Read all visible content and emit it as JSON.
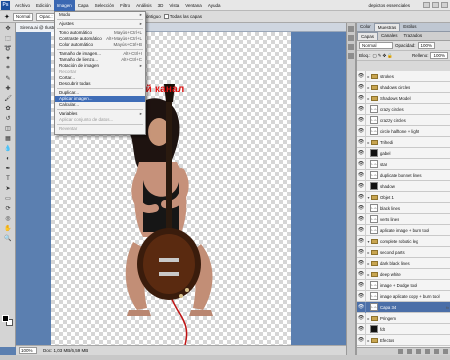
{
  "app": {
    "logo": "Ps",
    "doc_title_right": "depictos essenciales"
  },
  "menubar": [
    "Archivo",
    "Edición",
    "Imagen",
    "Capa",
    "Selección",
    "Filtro",
    "Análisis",
    "3D",
    "Vista",
    "Ventana",
    "Ayuda"
  ],
  "menubar_active_index": 2,
  "options": {
    "mode_label": "Normal",
    "opacity_label": "Opac.: 100%",
    "tolerance_label": "Tolerancia:",
    "tolerance_value": "32",
    "suavizar": "Suavizar",
    "contiguo": "Contiguo",
    "todas_capas": "Todas las capas"
  },
  "doc_tab": "Sirena.ai @ Ilustrador final.ai @ 100% (Capa 34, RGB/8) *",
  "status": {
    "zoom": "100%",
    "doc_info": "Doc: 1,03 MB/6,59 MB"
  },
  "annotation": "Внешний канал",
  "image_menu": {
    "rows": [
      {
        "label": "Modo",
        "shortcut": "▸",
        "disabled": false
      },
      {
        "sep": true
      },
      {
        "label": "Ajustes",
        "shortcut": "▸",
        "disabled": false
      },
      {
        "sep": true
      },
      {
        "label": "Tono automático",
        "shortcut": "Mayús+Ctrl+L",
        "disabled": false
      },
      {
        "label": "Contraste automático",
        "shortcut": "Alt+Mayús+Ctrl+L",
        "disabled": false
      },
      {
        "label": "Color automático",
        "shortcut": "Mayús+Ctrl+B",
        "disabled": false
      },
      {
        "sep": true
      },
      {
        "label": "Tamaño de imagen...",
        "shortcut": "Alt+Ctrl+I",
        "disabled": false
      },
      {
        "label": "Tamaño de lienzo...",
        "shortcut": "Alt+Ctrl+C",
        "disabled": false
      },
      {
        "label": "Rotación de imagen",
        "shortcut": "▸",
        "disabled": false
      },
      {
        "label": "Recortar",
        "shortcut": "",
        "disabled": true
      },
      {
        "label": "Cortar...",
        "shortcut": "",
        "disabled": false
      },
      {
        "label": "Descubrir todas",
        "shortcut": "",
        "disabled": false
      },
      {
        "sep": true
      },
      {
        "label": "Duplicar...",
        "shortcut": "",
        "disabled": false
      },
      {
        "label": "Aplicar imagen...",
        "shortcut": "",
        "disabled": false,
        "highlighted": true
      },
      {
        "label": "Calcular...",
        "shortcut": "",
        "disabled": false
      },
      {
        "sep": true
      },
      {
        "label": "Variables",
        "shortcut": "▸",
        "disabled": false
      },
      {
        "label": "Aplicar conjunto de datos...",
        "shortcut": "",
        "disabled": true
      },
      {
        "sep": true
      },
      {
        "label": "Reventar",
        "shortcut": "",
        "disabled": true
      }
    ]
  },
  "panel": {
    "top_tabs": [
      "Color",
      "Muestras",
      "Estilos"
    ],
    "tabs": [
      "Capas",
      "Canales",
      "Trazados"
    ],
    "blend_mode": "Normal",
    "opacity_label": "Opacidad:",
    "opacity_value": "100%",
    "lock_label": "Bloq.:",
    "fill_label": "Relleno:",
    "fill_value": "100%",
    "layers": [
      {
        "name": "strokes",
        "type": "folder",
        "eye": true,
        "arrow": "▸"
      },
      {
        "name": "shadows circles",
        "type": "folder",
        "eye": true,
        "arrow": "▸"
      },
      {
        "name": "Shadows Model",
        "type": "folder",
        "eye": true,
        "arrow": "▸"
      },
      {
        "name": "crazy circles",
        "type": "layer",
        "thumb": "check",
        "eye": true
      },
      {
        "name": "crazzy circles",
        "type": "layer",
        "thumb": "check",
        "eye": true
      },
      {
        "name": "circle halftone + light",
        "type": "layer",
        "thumb": "check",
        "eye": true
      },
      {
        "name": "Trihedi",
        "type": "folder",
        "eye": true,
        "arrow": "▸"
      },
      {
        "name": "gabel",
        "type": "layer",
        "thumb": "dark",
        "eye": true
      },
      {
        "name": "star",
        "type": "layer",
        "thumb": "check",
        "eye": true
      },
      {
        "name": "duplicate bonnet lines",
        "type": "layer",
        "thumb": "check",
        "eye": true
      },
      {
        "name": "shadow",
        "type": "layer",
        "thumb": "dark",
        "eye": true
      },
      {
        "name": "Objet 1",
        "type": "folder",
        "eye": true,
        "arrow": "▾"
      },
      {
        "name": "black lines",
        "type": "layer",
        "thumb": "check",
        "eye": true
      },
      {
        "name": "verts lines",
        "type": "layer",
        "thumb": "check",
        "eye": true
      },
      {
        "name": "aplicate image + burn tool",
        "type": "layer",
        "thumb": "check",
        "eye": true
      },
      {
        "name": "complete robotic leg",
        "type": "folder",
        "eye": true,
        "arrow": "▾"
      },
      {
        "name": "second parts",
        "type": "folder",
        "eye": true,
        "arrow": "▸"
      },
      {
        "name": "dark black lines",
        "type": "folder",
        "eye": true,
        "arrow": "▸"
      },
      {
        "name": "deep white",
        "type": "folder",
        "eye": true,
        "arrow": "▸"
      },
      {
        "name": "image + Dodge tool",
        "type": "layer",
        "thumb": "check",
        "eye": true
      },
      {
        "name": "image aplicate copy + burn tool",
        "type": "layer",
        "thumb": "check",
        "eye": true
      },
      {
        "name": "Capa 34",
        "type": "layer",
        "thumb": "check",
        "eye": true,
        "selected": true,
        "fx": "fx"
      },
      {
        "name": "Pringem",
        "type": "folder",
        "eye": true,
        "arrow": "▸"
      },
      {
        "name": "fdt",
        "type": "layer",
        "thumb": "dark",
        "eye": true
      },
      {
        "name": "Efectos",
        "type": "folder",
        "eye": true,
        "arrow": "▸"
      }
    ]
  },
  "toolbox": [
    "move-tool-icon",
    "marquee-tool-icon",
    "lasso-tool-icon",
    "magic-wand-icon",
    "crop-tool-icon",
    "eyedropper-icon",
    "healing-brush-icon",
    "brush-tool-icon",
    "clone-stamp-icon",
    "history-brush-icon",
    "eraser-icon",
    "gradient-tool-icon",
    "blur-tool-icon",
    "dodge-tool-icon",
    "pen-tool-icon",
    "type-tool-icon",
    "path-selection-icon",
    "shape-tool-icon",
    "3d-rotate-icon",
    "3d-orbit-icon",
    "hand-tool-icon",
    "zoom-tool-icon"
  ],
  "colors": {
    "accent": "#3b68b2",
    "annotation": "#e01010",
    "canvas_bg": "#5b7fb0"
  }
}
